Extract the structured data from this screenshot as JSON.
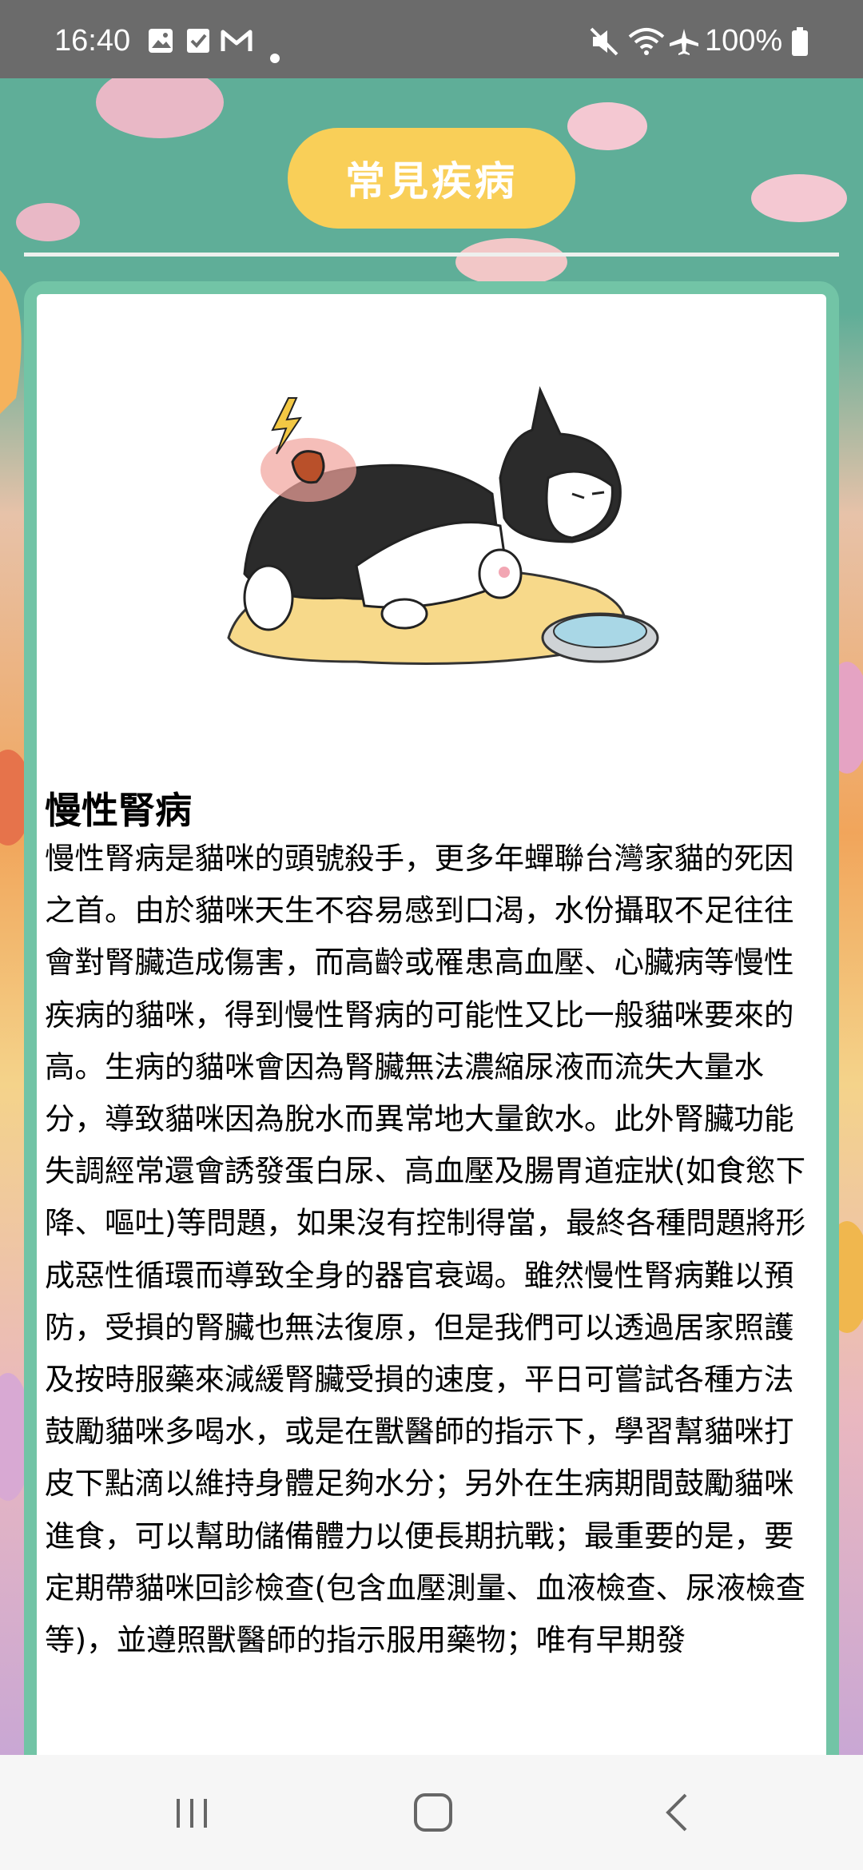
{
  "status_bar": {
    "time": "16:40",
    "left_icons": [
      "gallery-icon",
      "check-box-icon",
      "gmail-icon",
      "dot-icon"
    ],
    "right_icons": [
      "mute-icon",
      "wifi-icon",
      "airplane-icon",
      "battery-icon"
    ],
    "battery": "100%"
  },
  "page": {
    "title": "常見疾病",
    "accent": "#f9cf58",
    "card_color": "#72c4a6"
  },
  "article": {
    "illustration": "sick-cat-on-cushion-illustration",
    "title": "慢性腎病",
    "body": "慢性腎病是貓咪的頭號殺手，更多年蟬聯台灣家貓的死因之首。由於貓咪天生不容易感到口渴，水份攝取不足往往會對腎臟造成傷害，而高齡或罹患高血壓、心臟病等慢性疾病的貓咪，得到慢性腎病的可能性又比一般貓咪要來的高。生病的貓咪會因為腎臟無法濃縮尿液而流失大量水分，導致貓咪因為脫水而異常地大量飲水。此外腎臟功能失調經常還會誘發蛋白尿、高血壓及腸胃道症狀(如食慾下降、嘔吐)等問題，如果沒有控制得當，最終各種問題將形成惡性循環而導致全身的器官衰竭。雖然慢性腎病難以預防，受損的腎臟也無法復原，但是我們可以透過居家照護及按時服藥來減緩腎臟受損的速度，平日可嘗試各種方法鼓勵貓咪多喝水，或是在獸醫師的指示下，學習幫貓咪打皮下點滴以維持身體足夠水分；另外在生病期間鼓勵貓咪進食，可以幫助儲備體力以便長期抗戰；最重要的是，要定期帶貓咪回診檢查(包含血壓測量、血液檢查、尿液檢查等)，並遵照獸醫師的指示服用藥物；唯有早期發"
  },
  "nav_bar": {
    "buttons": [
      "recent-apps",
      "home",
      "back"
    ]
  }
}
